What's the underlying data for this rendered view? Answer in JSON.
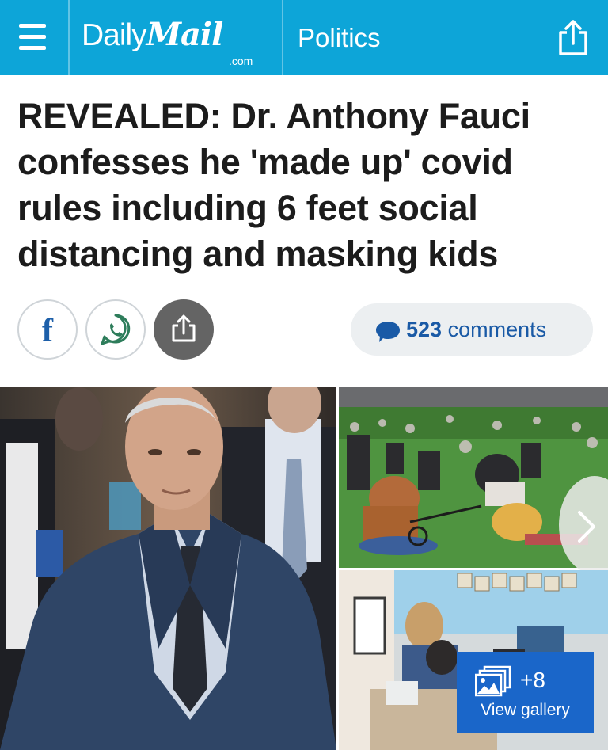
{
  "header": {
    "logo_daily": "Daily",
    "logo_mail": "Mail",
    "logo_com": ".com",
    "section": "Politics",
    "background_color": "#0da5d8"
  },
  "article": {
    "headline": "REVEALED: Dr. Anthony Fauci confesses he 'made up' covid rules including 6 feet social distancing and masking kids"
  },
  "social": {
    "facebook_glyph": "f",
    "comments_count": "523",
    "comments_label": "comments",
    "icons": [
      "facebook-icon",
      "whatsapp-icon",
      "share-icon",
      "comment-bubble-icon"
    ]
  },
  "gallery": {
    "count": "+8",
    "label": "View gallery",
    "button_color": "#1a66c9"
  }
}
